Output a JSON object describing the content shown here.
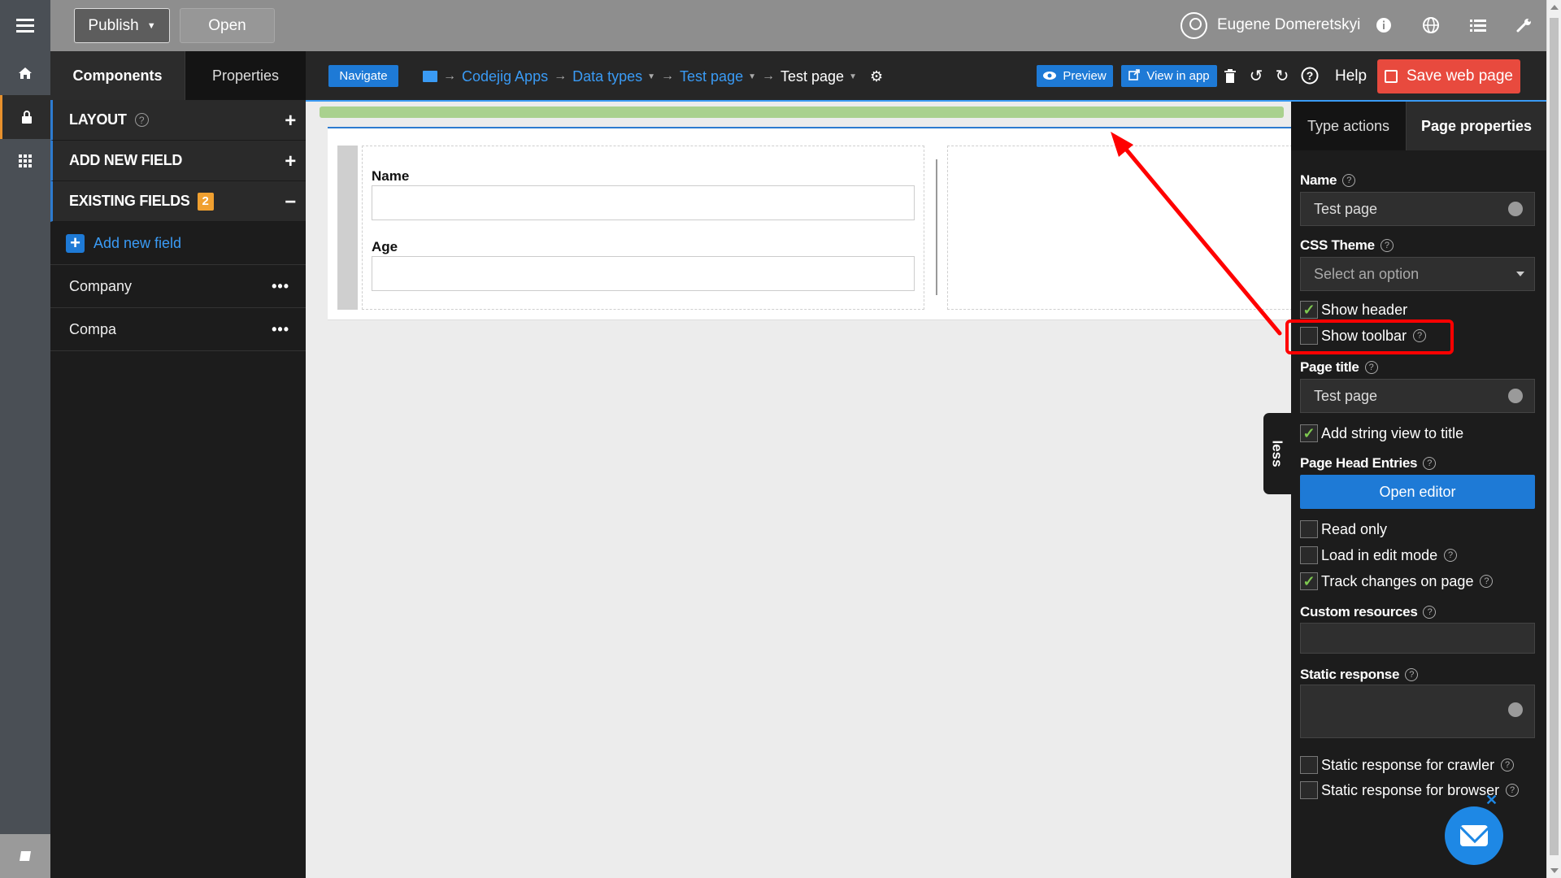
{
  "topbar": {
    "publish_label": "Publish",
    "open_label": "Open",
    "user_name": "Eugene Domeretskyi",
    "icons": [
      "info-icon",
      "globe-icon",
      "list-icon",
      "wrench-icon"
    ]
  },
  "rail": {
    "icons": [
      "home-icon",
      "lock-icon",
      "apps-grid-icon",
      "book-icon"
    ]
  },
  "components_panel": {
    "tabs": [
      "Components",
      "Properties"
    ],
    "sections": [
      {
        "label": "LAYOUT",
        "action": "+"
      },
      {
        "label": "ADD NEW FIELD",
        "action": "+"
      },
      {
        "label": "EXISTING FIELDS",
        "badge": "2",
        "action": "−"
      }
    ],
    "add_field_label": "Add new field",
    "fields": [
      "Company",
      "Compa"
    ],
    "more_label": "•••"
  },
  "toolbar": {
    "navigate_label": "Navigate",
    "breadcrumb": [
      "Codejig Apps",
      "Data types",
      "Test page",
      "Test page"
    ],
    "preview_label": "Preview",
    "view_in_app_label": "View in app",
    "help_label": "Help",
    "save_label": "Save web page"
  },
  "form": {
    "fields": [
      {
        "label": "Name",
        "value": ""
      },
      {
        "label": "Age",
        "value": ""
      }
    ]
  },
  "properties_panel": {
    "tabs": [
      "Type actions",
      "Page properties"
    ],
    "name_label": "Name",
    "name_value": "Test page",
    "css_theme_label": "CSS Theme",
    "css_theme_placeholder": "Select an option",
    "show_header_label": "Show header",
    "show_header_checked": true,
    "show_toolbar_label": "Show toolbar",
    "show_toolbar_checked": false,
    "page_title_label": "Page title",
    "page_title_value": "Test page",
    "add_string_view_label": "Add string view to title",
    "add_string_view_checked": true,
    "page_head_entries_label": "Page Head Entries",
    "open_editor_label": "Open editor",
    "read_only_label": "Read only",
    "read_only_checked": false,
    "load_edit_label": "Load in edit mode",
    "load_edit_checked": false,
    "track_changes_label": "Track changes on page",
    "track_changes_checked": true,
    "custom_resources_label": "Custom resources",
    "static_response_label": "Static response",
    "static_crawler_label": "Static response for crawler",
    "static_crawler_checked": false,
    "static_browser_label": "Static response for browser",
    "static_browser_checked": false
  },
  "less_label": "less",
  "colors": {
    "accent": "#1e7ad6",
    "save": "#e84a3e",
    "badge": "#f0a030",
    "progress": "#a9d18e",
    "annotation": "#ff0000"
  }
}
